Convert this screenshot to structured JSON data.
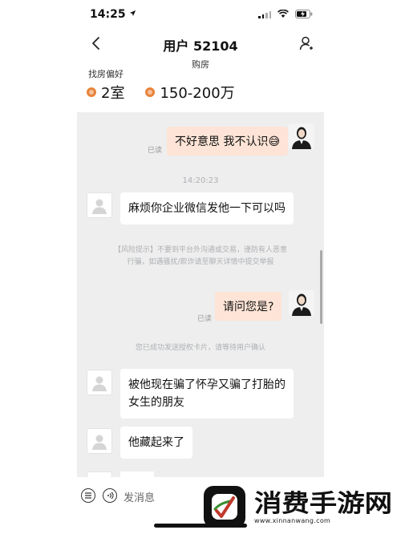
{
  "status_bar": {
    "time": "14:25",
    "icons": [
      "location-arrow-icon",
      "signal-icon",
      "wifi-icon",
      "battery-charging-icon"
    ]
  },
  "header": {
    "title": "用户 52104",
    "subtitle": "购房",
    "icons": [
      "chevron-left-icon",
      "user-profile-icon"
    ]
  },
  "preference": {
    "label": "找房偏好",
    "rooms": "2室",
    "budget": "150-200万"
  },
  "messages": [
    {
      "side": "right",
      "text": "不好意思  我不认识😅",
      "status": "已读"
    },
    {
      "type": "time",
      "text": "14:20:23"
    },
    {
      "side": "left",
      "text": "麻烦你企业微信发他一下可以吗"
    },
    {
      "type": "system",
      "line1": "【风险提示】不要到平台外沟通或交易，谨防有人恶意",
      "line2": "行骗，如遇骚扰/欺诈请至聊天详情中提交举报"
    },
    {
      "side": "right",
      "text": "请问您是?",
      "status": "已读"
    },
    {
      "type": "system",
      "text": "您已成功发送授权卡片，请等待用户确认"
    },
    {
      "side": "left",
      "line1": "被他现在骗了怀孕又骗了打胎的",
      "line2": "女生的朋友"
    },
    {
      "side": "left",
      "text": "他藏起来了"
    }
  ],
  "input": {
    "placeholder": "发消息"
  },
  "colors": {
    "accent": "#e8833a",
    "bubble_right": "#fde4d6",
    "chat_bg": "#eeeeee"
  },
  "watermark": {
    "name": "消费手游网",
    "url": "www.xinnanwang.com"
  }
}
